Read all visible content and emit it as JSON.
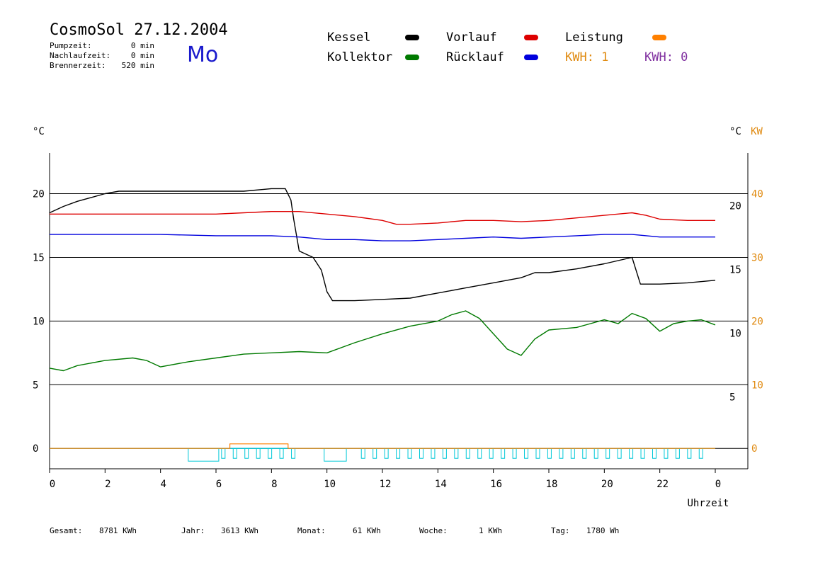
{
  "header": {
    "title": "CosmoSol 27.12.2004",
    "day": "Mo",
    "stats": [
      {
        "label": "Pumpzeit:",
        "value": "0 min"
      },
      {
        "label": "Nachlaufzeit:",
        "value": "0 min"
      },
      {
        "label": "Brennerzeit:",
        "value": "520 min"
      }
    ]
  },
  "legend": {
    "items": [
      {
        "label": "Kessel",
        "color": "#000000"
      },
      {
        "label": "Kollektor",
        "color": "#007a00"
      },
      {
        "label": "Vorlauf",
        "color": "#dd0000"
      },
      {
        "label": "Rücklauf",
        "color": "#0000dd"
      },
      {
        "label": "Leistung",
        "color": "#ff8000"
      }
    ],
    "kwh_1": "KWH: 1",
    "kwh_2": "KWH: 0",
    "kwh_1_color": "#e08a10",
    "kwh_2_color": "#8030a0"
  },
  "footer": [
    {
      "label": "Gesamt:",
      "value": "8781 KWh"
    },
    {
      "label": "Jahr:",
      "value": "3613 KWh"
    },
    {
      "label": "Monat:",
      "value": "61 KWh"
    },
    {
      "label": "Woche:",
      "value": "1 KWh"
    },
    {
      "label": "Tag:",
      "value": "1780 Wh"
    }
  ],
  "chart_data": {
    "type": "line",
    "x_label": "Uhrzeit",
    "y_left_unit": "°C",
    "y_right_unit": "°C",
    "y_right2_unit": "KW",
    "x_ticks": [
      "0",
      "2",
      "4",
      "6",
      "8",
      "10",
      "12",
      "14",
      "16",
      "18",
      "20",
      "22",
      "0"
    ],
    "y_left_ticks": [
      0,
      5,
      10,
      15,
      20
    ],
    "y_right_ticks": [
      5,
      10,
      15,
      20
    ],
    "y_right2_ticks": [
      0,
      10,
      20,
      30,
      40
    ],
    "x_range": [
      0,
      24
    ],
    "y_range": [
      -1.6,
      23.2
    ],
    "grid": "horizontal",
    "colors": {
      "pump": "#00c8d8",
      "power": "#ff8000",
      "axis": "#000000",
      "secondary_axis": "#e08a10"
    },
    "series": [
      {
        "name": "Kessel",
        "color": "#000000",
        "x": [
          0,
          0.5,
          1,
          1.5,
          2,
          2.5,
          2.7,
          7,
          8,
          8.5,
          8.7,
          8.8,
          9,
          9.5,
          9.8,
          10,
          10.2,
          10.5,
          11,
          12,
          13,
          14,
          15,
          16,
          17,
          17.5,
          18,
          19,
          20,
          21,
          21.3,
          22,
          23,
          24
        ],
        "y": [
          18.5,
          19,
          19.4,
          19.7,
          20,
          20.2,
          20.2,
          20.2,
          20.4,
          20.4,
          19.5,
          18,
          15.5,
          15,
          14,
          12.3,
          11.6,
          11.6,
          11.6,
          11.7,
          11.8,
          12.2,
          12.6,
          13,
          13.4,
          13.8,
          13.8,
          14.1,
          14.5,
          15,
          12.9,
          12.9,
          13,
          13.2
        ]
      },
      {
        "name": "Vorlauf",
        "color": "#dd0000",
        "x": [
          0,
          2,
          4,
          6,
          7,
          8,
          9,
          10,
          11,
          12,
          12.5,
          13,
          14,
          15,
          16,
          17,
          18,
          19,
          20,
          21,
          21.5,
          22,
          23,
          24
        ],
        "y": [
          18.4,
          18.4,
          18.4,
          18.4,
          18.5,
          18.6,
          18.6,
          18.4,
          18.2,
          17.9,
          17.6,
          17.6,
          17.7,
          17.9,
          17.9,
          17.8,
          17.9,
          18.1,
          18.3,
          18.5,
          18.3,
          18,
          17.9,
          17.9
        ]
      },
      {
        "name": "Rücklauf",
        "color": "#0000dd",
        "x": [
          0,
          2,
          4,
          6,
          8,
          9,
          10,
          11,
          12,
          13,
          14,
          15,
          16,
          17,
          18,
          19,
          20,
          21,
          22,
          23,
          24
        ],
        "y": [
          16.8,
          16.8,
          16.8,
          16.7,
          16.7,
          16.6,
          16.4,
          16.4,
          16.3,
          16.3,
          16.4,
          16.5,
          16.6,
          16.5,
          16.6,
          16.7,
          16.8,
          16.8,
          16.6,
          16.6,
          16.6
        ]
      },
      {
        "name": "Kollektor",
        "color": "#007a00",
        "x": [
          0,
          0.5,
          1,
          2,
          3,
          3.5,
          4,
          5,
          6,
          7,
          8,
          9,
          10,
          11,
          12,
          13,
          14,
          14.5,
          15,
          15.5,
          16,
          16.5,
          17,
          17.5,
          18,
          18.5,
          19,
          19.5,
          20,
          20.5,
          21,
          21.5,
          22,
          22.5,
          23,
          23.5,
          24
        ],
        "y": [
          6.3,
          6.1,
          6.5,
          6.9,
          7.1,
          6.9,
          6.4,
          6.8,
          7.1,
          7.4,
          7.5,
          7.6,
          7.5,
          8.3,
          9,
          9.6,
          10,
          10.5,
          10.8,
          10.2,
          9,
          7.8,
          7.3,
          8.6,
          9.3,
          9.4,
          9.5,
          9.8,
          10.1,
          9.8,
          10.6,
          10.2,
          9.2,
          9.8,
          10,
          10.1,
          9.7
        ]
      },
      {
        "name": "Leistung",
        "color": "#ff8000",
        "x": [
          0,
          6.5,
          6.5,
          8.6,
          8.6,
          24
        ],
        "y": [
          0,
          0,
          0.36,
          0.36,
          0,
          0
        ]
      }
    ]
  }
}
